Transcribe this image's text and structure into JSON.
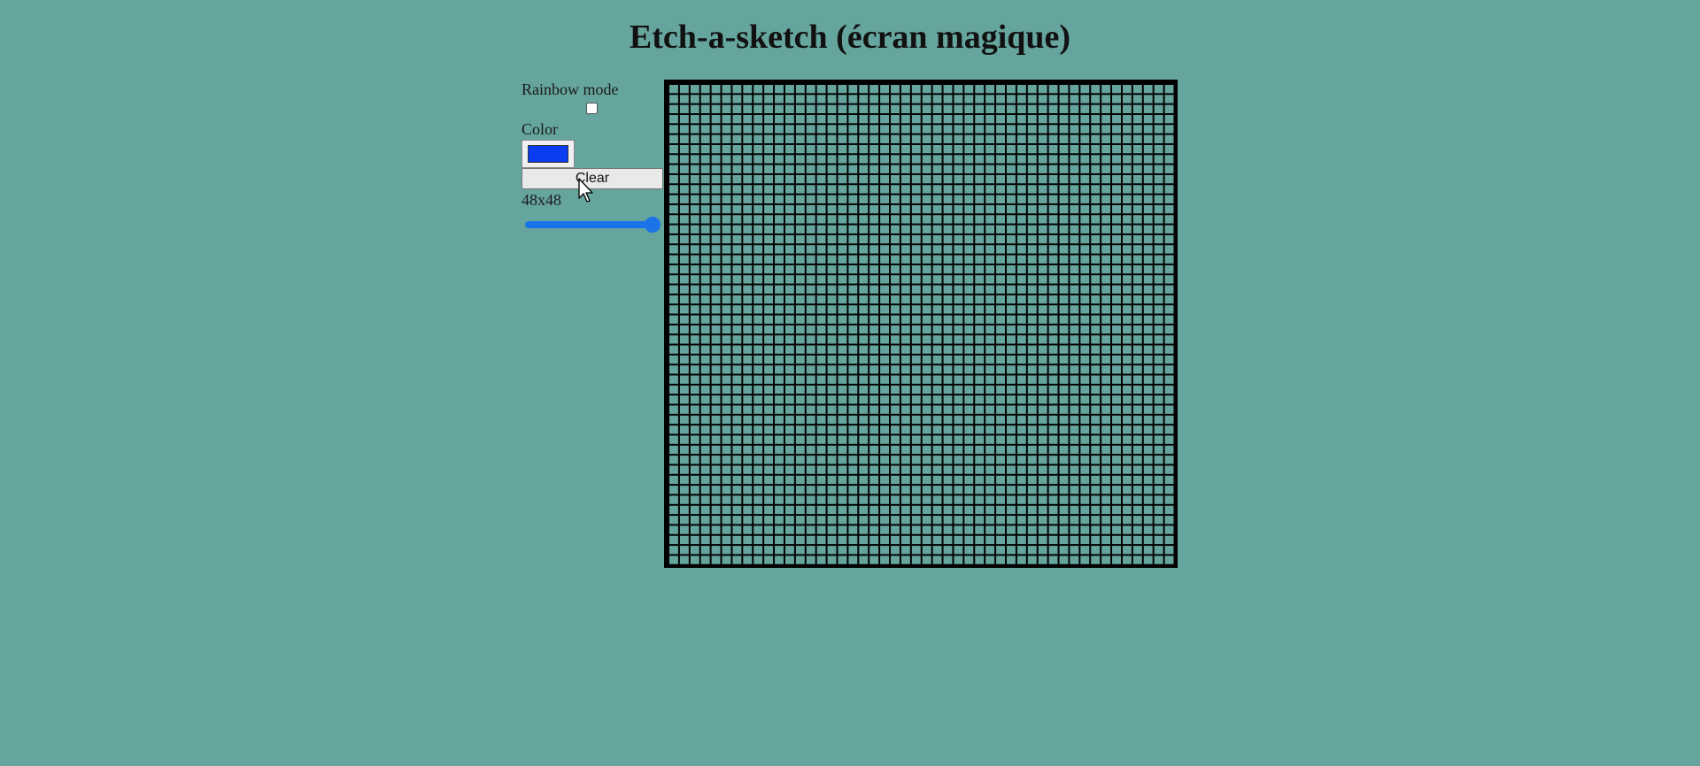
{
  "page": {
    "title": "Etch-a-sketch (écran magique)",
    "background_color": "#66a59e"
  },
  "controls": {
    "rainbow_label": "Rainbow mode",
    "rainbow_checked": false,
    "color_label": "Color",
    "color_value": "#0a3cf0",
    "clear_label": "Clear",
    "grid_size_label": "48x48",
    "slider_value_fraction": 1.0
  },
  "grid": {
    "columns": 48,
    "rows": 48,
    "line_color": "#000000",
    "cell_color": "#66a59e"
  },
  "icons": {
    "cursor": "mouse-pointer-icon"
  }
}
